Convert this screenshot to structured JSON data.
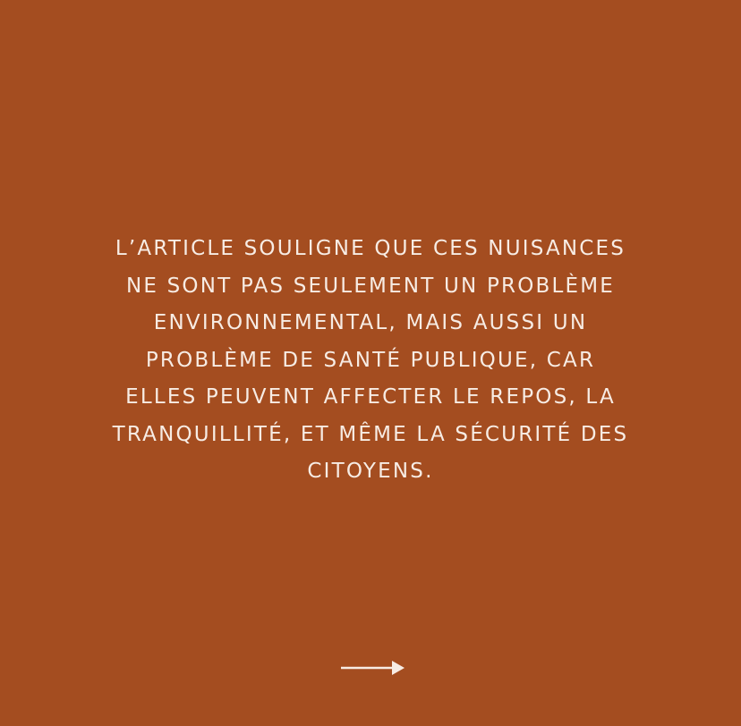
{
  "slide": {
    "background_color": "#a44d20",
    "text_color": "#f7ece4",
    "lines": [
      "L’ARTICLE SOULIGNE QUE CES NUISANCES",
      "NE SONT PAS SEULEMENT UN PROBLÈME",
      "ENVIRONNEMENTAL, MAIS AUSSI UN",
      "PROBLÈME DE SANTÉ PUBLIQUE, CAR",
      "ELLES PEUVENT AFFECTER LE REPOS, LA",
      "TRANQUILLITÉ, ET MÊME LA SÉCURITÉ DES",
      "CITOYENS."
    ],
    "next_icon": "right-arrow-icon"
  }
}
